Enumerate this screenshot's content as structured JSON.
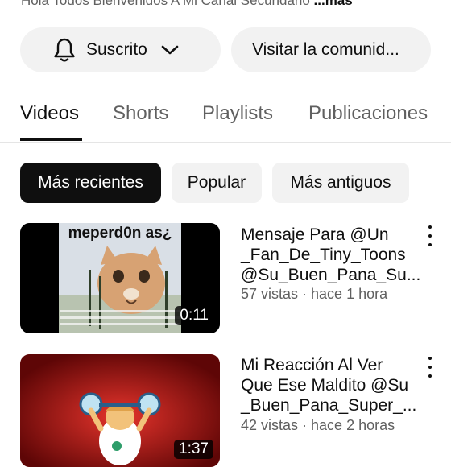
{
  "channel": {
    "description": "Hola Todos Bienvenidos A Mi Canal Secundario",
    "more_label": "...más"
  },
  "actions": {
    "subscribed_label": "Suscrito",
    "community_label": "Visitar la comunid..."
  },
  "tabs": [
    {
      "label": "Videos",
      "active": true
    },
    {
      "label": "Shorts"
    },
    {
      "label": "Playlists"
    },
    {
      "label": "Publicaciones"
    }
  ],
  "filters": [
    {
      "label": "Más recientes",
      "active": true
    },
    {
      "label": "Popular"
    },
    {
      "label": "Más antiguos"
    }
  ],
  "videos": [
    {
      "title_lines": [
        "Mensaje Para @Un",
        "_Fan_De_Tiny_Toons",
        "@Su_Buen_Pana_Su..."
      ],
      "meta": "57 vistas · hace 1 hora",
      "duration": "0:11",
      "thumb_caption": "meperd0n as¿"
    },
    {
      "title_lines": [
        "Mi Reacción Al Ver",
        "Que Ese Maldito @Su",
        "_Buen_Pana_Super_..."
      ],
      "meta": "42 vistas · hace 2 horas",
      "duration": "1:37"
    }
  ],
  "icons": {
    "bell": "bell-icon",
    "chevron": "chevron-down-icon",
    "more": "more-vert-icon"
  }
}
